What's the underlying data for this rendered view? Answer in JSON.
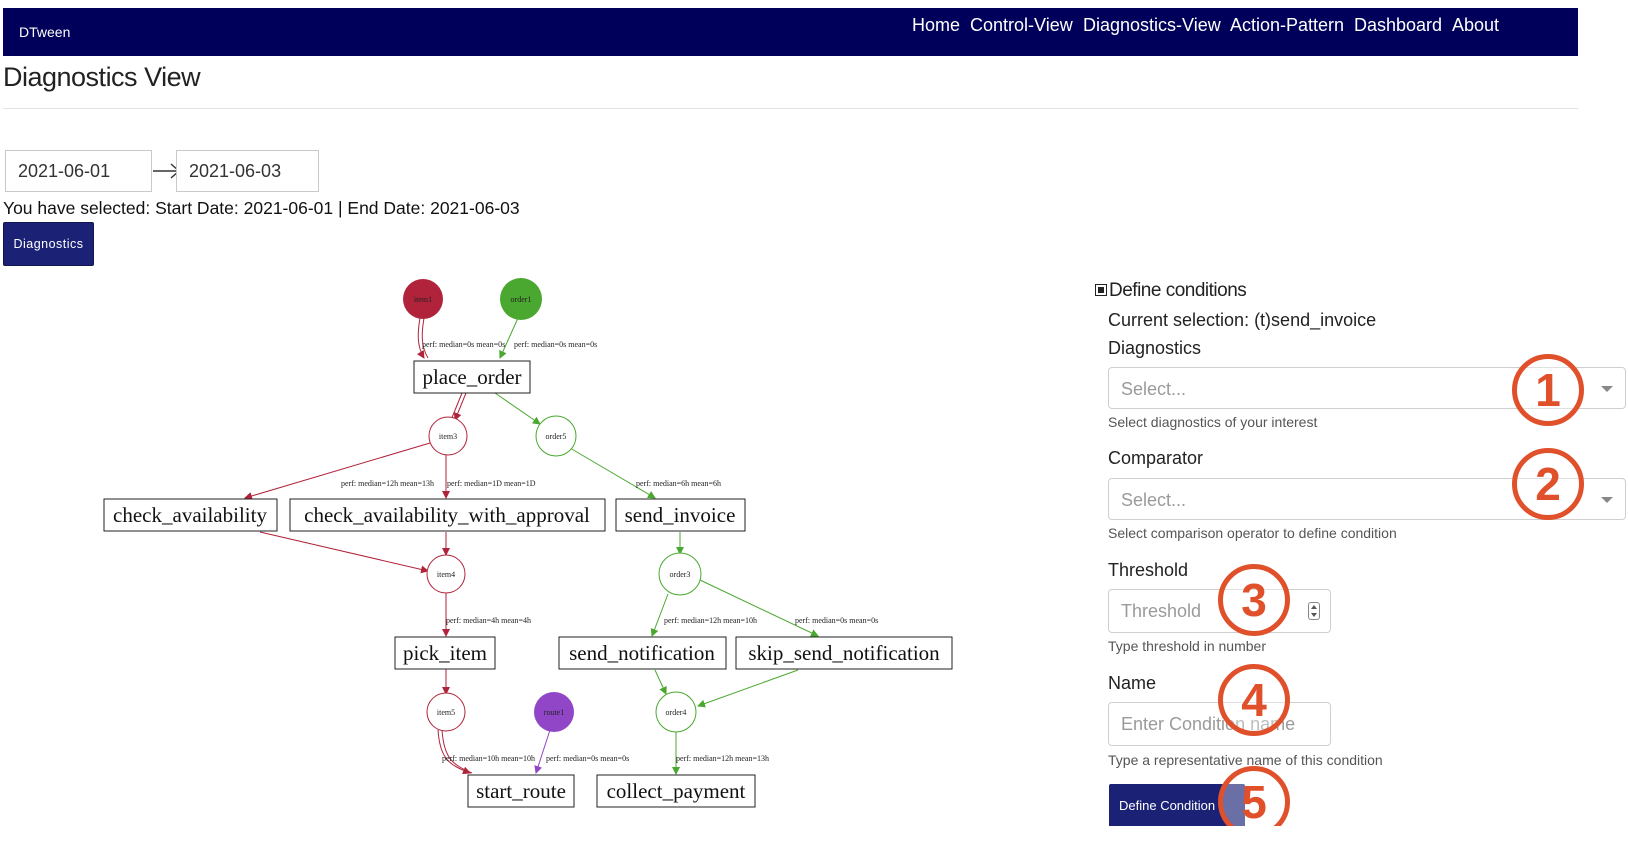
{
  "app": {
    "brand": "DTween"
  },
  "nav": {
    "home": "Home",
    "control_view": "Control-View",
    "diagnostics_view": "Diagnostics-View",
    "action_pattern": "Action-Pattern",
    "dashboard": "Dashboard",
    "about": "About"
  },
  "page": {
    "title": "Diagnostics View"
  },
  "date_range": {
    "start": "2021-06-01",
    "end": "2021-06-03",
    "selection_text": "You have selected: Start Date: 2021-06-01 | End Date: 2021-06-03"
  },
  "diagnostics_button": "Diagnostics",
  "graph": {
    "objects": [
      {
        "label": "item1",
        "color": "#b0233a"
      },
      {
        "label": "order1",
        "color": "#4aa830"
      },
      {
        "label": "route1",
        "color": "#9146c8"
      }
    ],
    "place_nodes": [
      "item3",
      "order5",
      "item4",
      "order3",
      "item5",
      "order4"
    ],
    "transitions": [
      "place_order",
      "check_availability",
      "check_availability_with_approval",
      "send_invoice",
      "pick_item",
      "send_notification",
      "skip_send_notification",
      "start_route",
      "collect_payment"
    ],
    "edge_labels": [
      "perf: median=0s mean=0s",
      "perf: median=0s mean=0s",
      "perf: median=12h mean=13h",
      "perf: median=1D mean=1D",
      "perf: median=6h mean=6h",
      "perf: median=4h mean=4h",
      "perf: median=12h mean=10h",
      "perf: median=0s mean=0s",
      "perf: median=10h mean=10h",
      "perf: median=0s mean=0s",
      "perf: median=12h mean=13h"
    ],
    "colors": {
      "item": "#b0233a",
      "order": "#4aa830",
      "route": "#9146c8"
    }
  },
  "conditions": {
    "header": "Define conditions",
    "current_selection": "Current selection: (t)send_invoice",
    "diagnostics": {
      "label": "Diagnostics",
      "placeholder": "Select...",
      "help": "Select diagnostics of your interest"
    },
    "comparator": {
      "label": "Comparator",
      "placeholder": "Select...",
      "help": "Select comparison operator to define condition"
    },
    "threshold": {
      "label": "Threshold",
      "placeholder": "Threshold",
      "help": "Type threshold in number"
    },
    "name": {
      "label": "Name",
      "placeholder": "Enter Condition name",
      "help": "Type a representative name of this condition"
    },
    "button": "Define Condition"
  },
  "annotations": [
    "1",
    "2",
    "3",
    "4",
    "5"
  ],
  "accent_color": "#e0502b"
}
